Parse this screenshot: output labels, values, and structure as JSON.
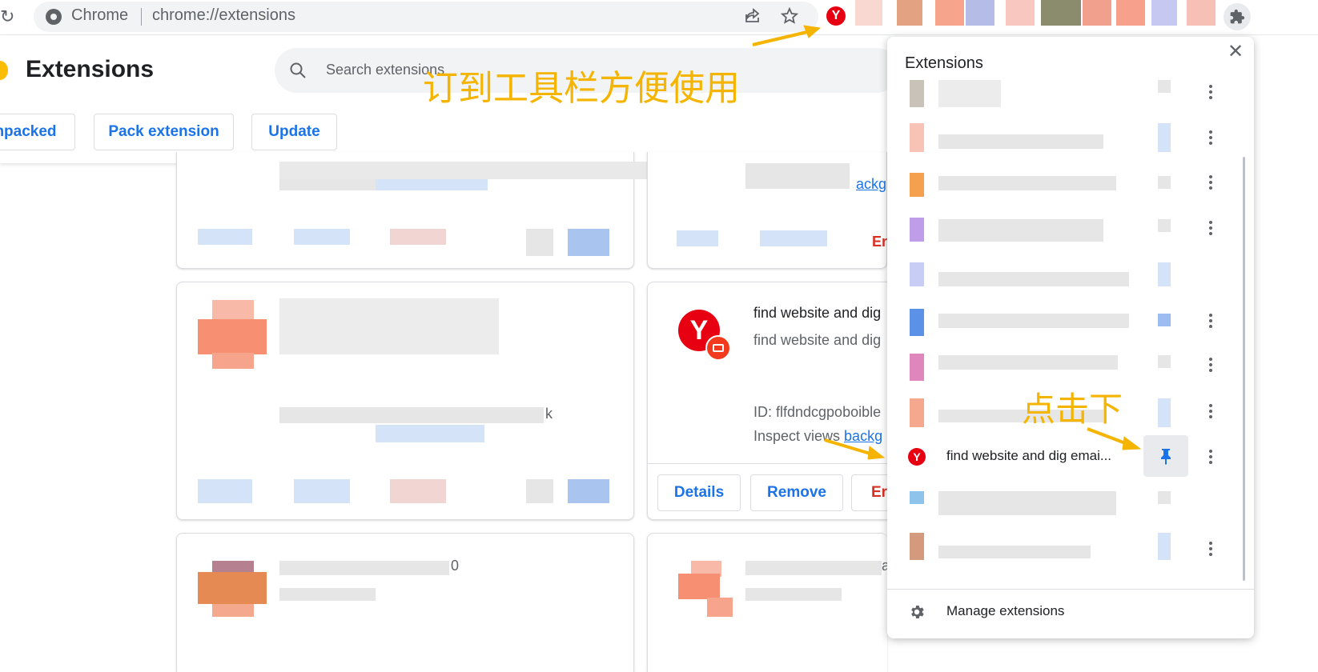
{
  "toolbar": {
    "site_chip": "Chrome",
    "url": "chrome://extensions"
  },
  "page": {
    "title": "Extensions",
    "search_placeholder": "Search extensions",
    "buttons": {
      "load_unpacked": "npacked",
      "pack_extension": "Pack extension",
      "update": "Update"
    }
  },
  "cards": {
    "top_right_partial_text": "ackg",
    "top_right_err": "Err",
    "mid_right": {
      "name": "find website and dig",
      "description": "find website and dig",
      "id_text": "ID: flfdndcgpoboible",
      "inspect_label": "Inspect views ",
      "inspect_link": "backg",
      "details": "Details",
      "remove": "Remove",
      "errors": "Err"
    },
    "mid_left_tail": "k",
    "bottom_left_tail": "0",
    "bottom_right_tail": "a"
  },
  "popup": {
    "title": "Extensions",
    "pinned_item_name": "find website and dig emai...",
    "manage_label": "Manage extensions"
  },
  "annotations": {
    "pin_to_toolbar": "订到工具栏方便使用",
    "click_here": "点击下"
  },
  "colors": {
    "accent_blue": "#1a73e8",
    "annotation_yellow": "#f5b400",
    "yandex_red": "#e60012"
  }
}
